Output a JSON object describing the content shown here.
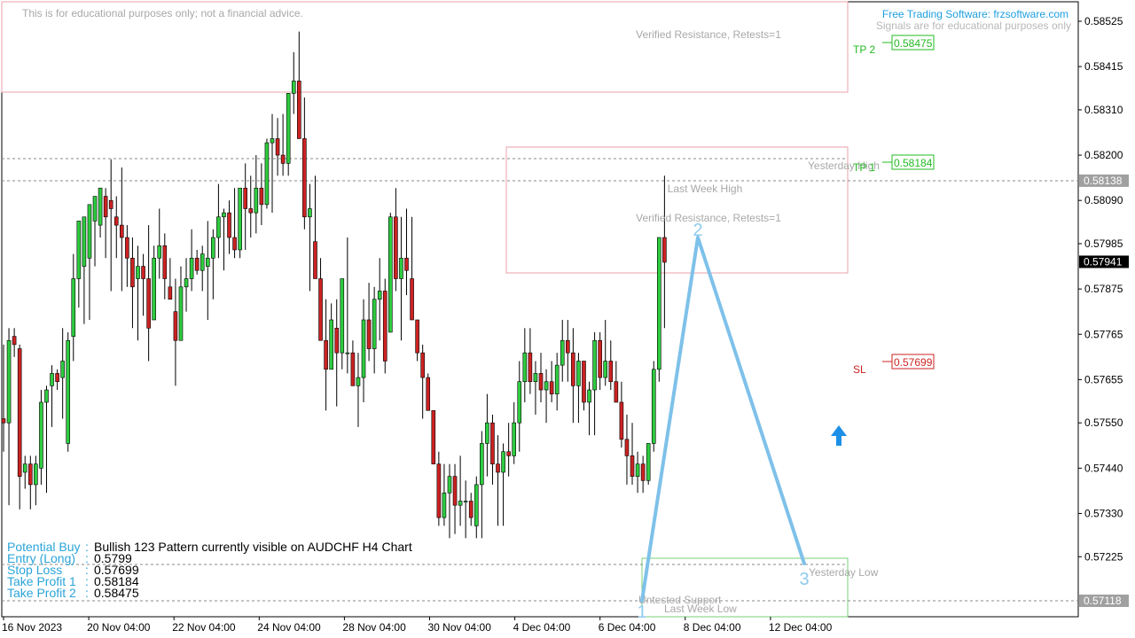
{
  "chart_data": {
    "type": "candlestick",
    "symbol": "AUDCHF",
    "timeframe": "H4",
    "price_range": [
      0.5706,
      0.5858
    ],
    "price_ticks": [
      "0.58525",
      "0.58415",
      "0.58310",
      "0.58200",
      "0.58090",
      "0.57985",
      "0.57875",
      "0.57765",
      "0.57655",
      "0.57550",
      "0.57440",
      "0.57330",
      "0.57225"
    ],
    "time_labels": [
      "16 Nov 2023",
      "20 Nov 04:00",
      "22 Nov 04:00",
      "24 Nov 04:00",
      "28 Nov 04:00",
      "30 Nov 04:00",
      "4 Dec 04:00",
      "6 Dec 04:00",
      "8 Dec 04:00",
      "12 Dec 04:00"
    ],
    "price_tags": [
      {
        "id": "ref",
        "text": "0.58138",
        "price": 0.58138,
        "bg": "#a0a0a0",
        "fg": "#ffffff"
      },
      {
        "id": "current",
        "text": "0.57941",
        "price": 0.57941,
        "bg": "#000000",
        "fg": "#ffffff"
      },
      {
        "id": "low",
        "text": "0.57118",
        "price": 0.57118,
        "bg": "#a0a0a0",
        "fg": "#ffffff"
      }
    ],
    "candles": [
      [
        0.5756,
        0.5774,
        0.5748,
        0.5755
      ],
      [
        0.5755,
        0.5778,
        0.5735,
        0.5775
      ],
      [
        0.5776,
        0.5778,
        0.5771,
        0.5774
      ],
      [
        0.5773,
        0.5774,
        0.5734,
        0.5742
      ],
      [
        0.5743,
        0.5747,
        0.5739,
        0.5745
      ],
      [
        0.5745,
        0.5747,
        0.5734,
        0.574
      ],
      [
        0.574,
        0.5747,
        0.5735,
        0.5745
      ],
      [
        0.5744,
        0.5763,
        0.574,
        0.576
      ],
      [
        0.576,
        0.5764,
        0.5738,
        0.5763
      ],
      [
        0.5764,
        0.5769,
        0.5754,
        0.5767
      ],
      [
        0.5767,
        0.5768,
        0.5763,
        0.5765
      ],
      [
        0.5766,
        0.5778,
        0.5756,
        0.577
      ],
      [
        0.575,
        0.5777,
        0.5748,
        0.5775
      ],
      [
        0.5776,
        0.5796,
        0.577,
        0.579
      ],
      [
        0.579,
        0.58,
        0.5783,
        0.5804
      ],
      [
        0.5793,
        0.5802,
        0.5779,
        0.5805
      ],
      [
        0.5795,
        0.5802,
        0.578,
        0.5808
      ],
      [
        0.5804,
        0.581,
        0.5793,
        0.581
      ],
      [
        0.5803,
        0.5812,
        0.58,
        0.5812
      ],
      [
        0.581,
        0.5812,
        0.5795,
        0.5805
      ],
      [
        0.5809,
        0.5819,
        0.5787,
        0.5807
      ],
      [
        0.5805,
        0.581,
        0.5795,
        0.5803
      ],
      [
        0.5803,
        0.5817,
        0.5787,
        0.58
      ],
      [
        0.58,
        0.5803,
        0.5788,
        0.5795
      ],
      [
        0.5795,
        0.58,
        0.5778,
        0.5788
      ],
      [
        0.579,
        0.5798,
        0.5775,
        0.5793
      ],
      [
        0.5793,
        0.5796,
        0.5781,
        0.579
      ],
      [
        0.579,
        0.5803,
        0.577,
        0.5778
      ],
      [
        0.578,
        0.5798,
        0.578,
        0.5795
      ],
      [
        0.5795,
        0.5807,
        0.579,
        0.5798
      ],
      [
        0.5798,
        0.5801,
        0.5785,
        0.579
      ],
      [
        0.5788,
        0.5795,
        0.579,
        0.5785
      ],
      [
        0.5782,
        0.579,
        0.5764,
        0.5775
      ],
      [
        0.5775,
        0.5793,
        0.5775,
        0.5788
      ],
      [
        0.5788,
        0.5795,
        0.5782,
        0.579
      ],
      [
        0.579,
        0.5802,
        0.5787,
        0.5795
      ],
      [
        0.5795,
        0.5797,
        0.5791,
        0.5792
      ],
      [
        0.5792,
        0.5798,
        0.5787,
        0.5796
      ],
      [
        0.5793,
        0.5804,
        0.578,
        0.5795
      ],
      [
        0.5795,
        0.5802,
        0.5785,
        0.58
      ],
      [
        0.58,
        0.5813,
        0.5795,
        0.5805
      ],
      [
        0.5805,
        0.5807,
        0.5792,
        0.5806
      ],
      [
        0.5806,
        0.5809,
        0.5796,
        0.58
      ],
      [
        0.58,
        0.5812,
        0.5795,
        0.5797
      ],
      [
        0.5797,
        0.5812,
        0.5795,
        0.5812
      ],
      [
        0.5812,
        0.5818,
        0.5797,
        0.5807
      ],
      [
        0.5807,
        0.5815,
        0.58,
        0.5806
      ],
      [
        0.5806,
        0.582,
        0.5801,
        0.5812
      ],
      [
        0.5812,
        0.5818,
        0.5803,
        0.5808
      ],
      [
        0.5808,
        0.5824,
        0.5807,
        0.5823
      ],
      [
        0.5823,
        0.583,
        0.5806,
        0.5824
      ],
      [
        0.5824,
        0.5829,
        0.5815,
        0.582
      ],
      [
        0.582,
        0.583,
        0.5815,
        0.5818
      ],
      [
        0.5818,
        0.5835,
        0.5815,
        0.5835
      ],
      [
        0.5835,
        0.5845,
        0.583,
        0.5838
      ],
      [
        0.5838,
        0.585,
        0.583,
        0.5824
      ],
      [
        0.5824,
        0.5834,
        0.5802,
        0.5805
      ],
      [
        0.5805,
        0.5813,
        0.5787,
        0.5807
      ],
      [
        0.5799,
        0.5815,
        0.579,
        0.579
      ],
      [
        0.579,
        0.5795,
        0.578,
        0.5775
      ],
      [
        0.5775,
        0.5785,
        0.5758,
        0.5768
      ],
      [
        0.5768,
        0.5784,
        0.577,
        0.578
      ],
      [
        0.5778,
        0.5785,
        0.5759,
        0.5772
      ],
      [
        0.5772,
        0.579,
        0.5768,
        0.579
      ],
      [
        0.5772,
        0.58,
        0.5767,
        0.5772
      ],
      [
        0.5772,
        0.5775,
        0.5764,
        0.5764
      ],
      [
        0.5764,
        0.5772,
        0.5754,
        0.5766
      ],
      [
        0.5766,
        0.5785,
        0.576,
        0.578
      ],
      [
        0.578,
        0.5789,
        0.577,
        0.5773
      ],
      [
        0.5773,
        0.5788,
        0.5767,
        0.5785
      ],
      [
        0.5785,
        0.5795,
        0.5775,
        0.5787
      ],
      [
        0.5787,
        0.579,
        0.5767,
        0.577
      ],
      [
        0.5777,
        0.5806,
        0.5777,
        0.5805
      ],
      [
        0.5805,
        0.5812,
        0.5787,
        0.579
      ],
      [
        0.579,
        0.5805,
        0.5775,
        0.5795
      ],
      [
        0.5795,
        0.5807,
        0.5786,
        0.5792
      ],
      [
        0.579,
        0.5805,
        0.578,
        0.578
      ],
      [
        0.578,
        0.578,
        0.577,
        0.5772
      ],
      [
        0.5772,
        0.5774,
        0.5756,
        0.5766
      ],
      [
        0.5766,
        0.5767,
        0.5758,
        0.5758
      ],
      [
        0.5758,
        0.5755,
        0.575,
        0.5745
      ],
      [
        0.5745,
        0.5748,
        0.573,
        0.5732
      ],
      [
        0.5732,
        0.5745,
        0.573,
        0.5738
      ],
      [
        0.5738,
        0.5745,
        0.5727,
        0.5742
      ],
      [
        0.5742,
        0.5745,
        0.5728,
        0.5735
      ],
      [
        0.5735,
        0.5747,
        0.573,
        0.5736
      ],
      [
        0.5736,
        0.5741,
        0.5727,
        0.5736
      ],
      [
        0.5736,
        0.5738,
        0.573,
        0.5732
      ],
      [
        0.573,
        0.5742,
        0.5727,
        0.574
      ],
      [
        0.574,
        0.5753,
        0.5727,
        0.575
      ],
      [
        0.575,
        0.5762,
        0.5742,
        0.5755
      ],
      [
        0.5755,
        0.5757,
        0.574,
        0.5745
      ],
      [
        0.5745,
        0.5752,
        0.573,
        0.5743
      ],
      [
        0.5743,
        0.575,
        0.573,
        0.5748
      ],
      [
        0.5748,
        0.5755,
        0.5742,
        0.5747
      ],
      [
        0.5747,
        0.576,
        0.5745,
        0.5755
      ],
      [
        0.5755,
        0.577,
        0.5748,
        0.5765
      ],
      [
        0.5765,
        0.5778,
        0.576,
        0.5772
      ],
      [
        0.5772,
        0.5778,
        0.5762,
        0.5765
      ],
      [
        0.5765,
        0.577,
        0.5757,
        0.5767
      ],
      [
        0.5767,
        0.5772,
        0.576,
        0.5763
      ],
      [
        0.5763,
        0.5768,
        0.5755,
        0.5765
      ],
      [
        0.5765,
        0.577,
        0.576,
        0.5762
      ],
      [
        0.5762,
        0.5772,
        0.5758,
        0.5769
      ],
      [
        0.5769,
        0.578,
        0.5765,
        0.5775
      ],
      [
        0.5775,
        0.578,
        0.5765,
        0.5772
      ],
      [
        0.5772,
        0.5778,
        0.5755,
        0.5764
      ],
      [
        0.5764,
        0.5772,
        0.5755,
        0.577
      ],
      [
        0.577,
        0.577,
        0.5758,
        0.576
      ],
      [
        0.576,
        0.5765,
        0.5752,
        0.5763
      ],
      [
        0.5763,
        0.5777,
        0.5752,
        0.5775
      ],
      [
        0.5775,
        0.5777,
        0.5763,
        0.5766
      ],
      [
        0.5766,
        0.578,
        0.5764,
        0.577
      ],
      [
        0.577,
        0.5775,
        0.5763,
        0.5765
      ],
      [
        0.5765,
        0.577,
        0.576,
        0.576
      ],
      [
        0.576,
        0.5765,
        0.5749,
        0.5751
      ],
      [
        0.5751,
        0.5757,
        0.574,
        0.5747
      ],
      [
        0.5747,
        0.5755,
        0.574,
        0.5742
      ],
      [
        0.5742,
        0.5748,
        0.5738,
        0.5745
      ],
      [
        0.5745,
        0.5747,
        0.5738,
        0.5741
      ],
      [
        0.5741,
        0.575,
        0.574,
        0.575
      ],
      [
        0.575,
        0.577,
        0.5748,
        0.5768
      ],
      [
        0.5768,
        0.579,
        0.5765,
        0.58
      ],
      [
        0.58,
        0.5815,
        0.5778,
        0.5794
      ]
    ]
  },
  "header": {
    "disclaimer": "This is for educational purposes only; not a financial advice.",
    "brand": "Free Trading Software: frzsoftware.com",
    "brand_note": "Signals are for educational purposes only"
  },
  "zones": {
    "resistance_top_label": "Verified Resistance, Retests=1",
    "resistance_mid_label": "Verified Resistance, Retests=1",
    "last_week_high": "Last Week High",
    "yesterday_high": "Yesterday High",
    "yesterday_low": "Yesterday Low",
    "untested_support": "Untested Support",
    "last_week_low": "Last Week Low"
  },
  "levels": {
    "tp2_label": "TP 2",
    "tp2_value": "0.58475",
    "tp1_label": "TP 1",
    "tp1_value": "0.58184",
    "sl_label": "SL",
    "sl_value": "0.57699"
  },
  "pattern": {
    "p1": "1",
    "p2": "2",
    "p3": "3"
  },
  "info_panel": {
    "rows": [
      {
        "key": "Potential Buy",
        "sep": ":",
        "value": "Bullish 123 Pattern currently visible on AUDCHF H4 Chart"
      },
      {
        "key": "Entry (Long)",
        "sep": ":",
        "value": "0.5799"
      },
      {
        "key": "Stop Loss",
        "sep": ":",
        "value": "0.57699"
      },
      {
        "key": "Take Profit 1",
        "sep": ":",
        "value": "0.58184"
      },
      {
        "key": "Take Profit 2",
        "sep": ":",
        "value": "0.58475"
      }
    ]
  },
  "colors": {
    "bull": "#2ecc40",
    "bear": "#cc2222",
    "zone_border": "#e8a0a8",
    "support_border": "#7ad27a",
    "pattern_line": "#7ec1ea",
    "arrow": "#1e8fe6",
    "info_key": "#2aa4d8",
    "brand": "#1e9fe0",
    "tp": "#22bb22",
    "sl": "#cc2222"
  }
}
